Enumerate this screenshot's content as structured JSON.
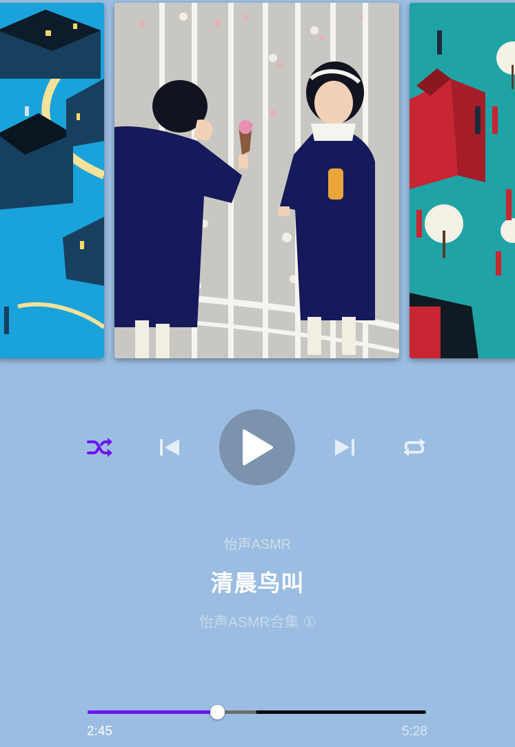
{
  "colors": {
    "background": "#9bbde1",
    "accent": "#6d12f2",
    "play_button": "#7b93ad",
    "track": "#0b0b0b",
    "buffer": "#6e6e6e"
  },
  "carousel": {
    "cards": [
      {
        "name": "album-art-previous",
        "subject": "illustration of blue houses along a yellow road"
      },
      {
        "name": "album-art-current",
        "subject": "illustration of two girls in navy dresses with melting ice cream at a white fence"
      },
      {
        "name": "album-art-next",
        "subject": "illustration of a red building and people walking among white trees"
      }
    ]
  },
  "controls": {
    "shuffle_icon": "shuffle-icon",
    "previous_icon": "skip-previous-icon",
    "play_icon": "play-icon",
    "next_icon": "skip-next-icon",
    "repeat_icon": "repeat-icon"
  },
  "track": {
    "artist": "怡声ASMR",
    "title": "清晨鸟叫",
    "album": "怡声ASMR合集 ①"
  },
  "progress": {
    "current_time": "2:45",
    "total_time": "5:28",
    "played_fraction": 0.382,
    "buffered_fraction": 0.499
  }
}
